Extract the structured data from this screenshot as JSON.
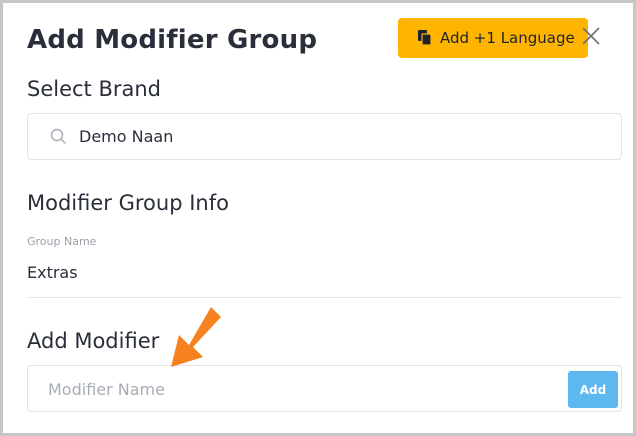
{
  "dialog": {
    "title": "Add Modifier Group",
    "add_language_label": "Add +1 Language",
    "close_icon": "close-icon"
  },
  "brand": {
    "heading": "Select Brand",
    "search_value": "Demo Naan",
    "search_icon": "search-icon"
  },
  "group_info": {
    "heading": "Modifier Group Info",
    "group_name_label": "Group Name",
    "group_name_value": "Extras"
  },
  "add_modifier": {
    "heading": "Add Modifier",
    "placeholder": "Modifier Name",
    "add_button_label": "Add"
  },
  "colors": {
    "accent_yellow": "#ffb400",
    "add_button_blue": "#5cb8ef",
    "annotation_arrow": "#f5821f"
  }
}
